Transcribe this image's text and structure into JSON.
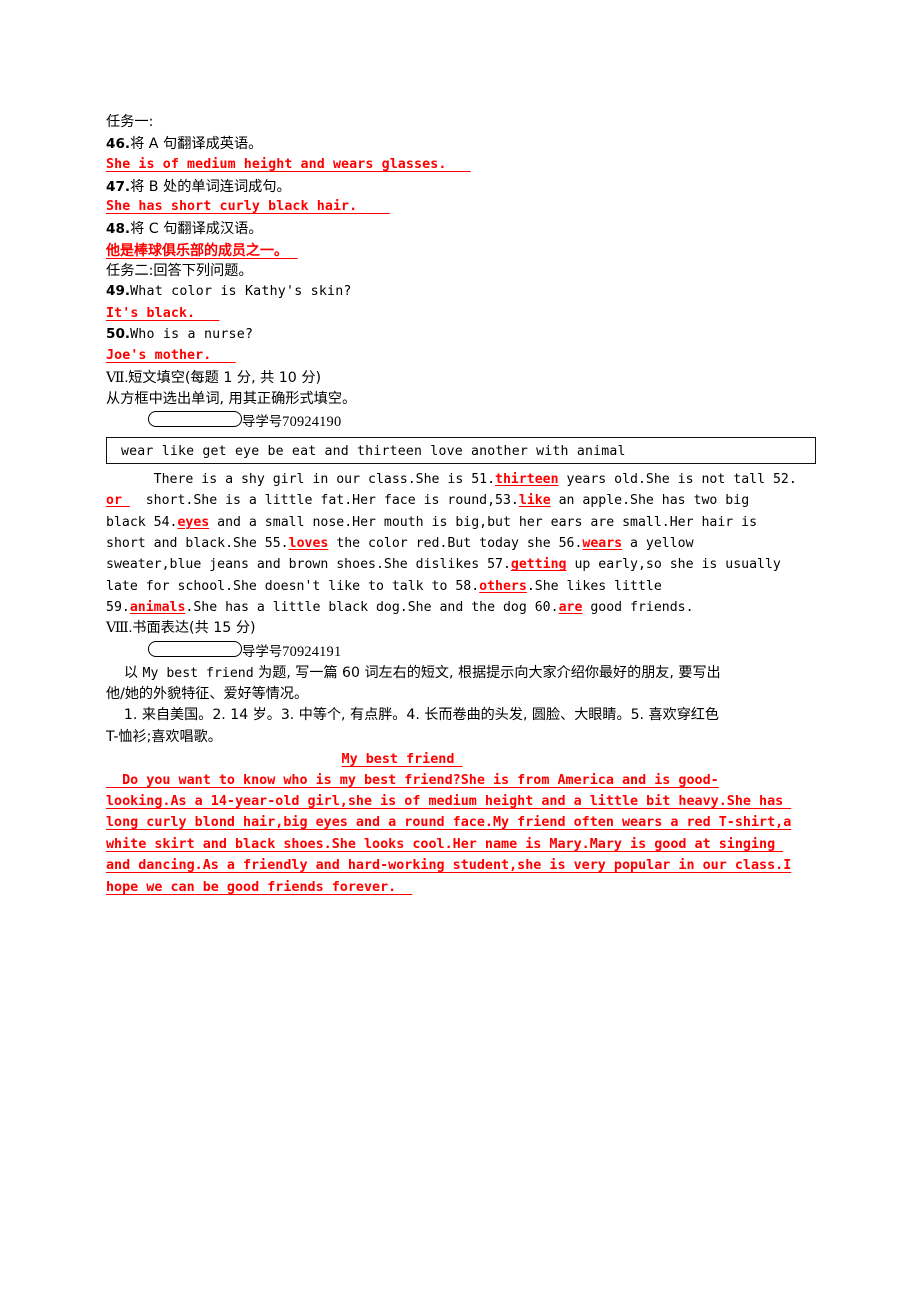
{
  "task_one": {
    "heading": "任务一:",
    "items": [
      {
        "num": "46.",
        "prompt": "将 A 句翻译成英语。",
        "answer": "She is of medium height and wears glasses.",
        "answer_lang": "en"
      },
      {
        "num": "47.",
        "prompt": "将 B 处的单词连词成句。",
        "answer": "She has short curly black hair.",
        "answer_lang": "en"
      },
      {
        "num": "48.",
        "prompt": "将 C 句翻译成汉语。",
        "answer": "他是棒球俱乐部的成员之一。",
        "answer_lang": "cn"
      }
    ]
  },
  "task_two": {
    "heading": "任务二:回答下列问题。",
    "items": [
      {
        "num": "49.",
        "prompt": "What color is Kathy's skin?",
        "answer": "It's black.",
        "answer_lang": "en"
      },
      {
        "num": "50.",
        "prompt": "Who is a nurse?",
        "answer": "Joe's mother.",
        "answer_lang": "en"
      }
    ]
  },
  "section_seven": {
    "number": "Ⅶ.",
    "title": "短文填空(每题 1 分, 共 10 分)",
    "instruction": "从方框中选出单词, 用其正确形式填空。",
    "guide_label": "导学号",
    "guide_number": "70924190",
    "word_bank": "wear  like  get  eye  be  eat  and  thirteen  love  another  with  animal",
    "passage_lines": [
      [
        {
          "t": "      There is a shy girl in our class.She is 51."
        },
        {
          "t": "thirteen",
          "fill": true
        },
        {
          "t": " years old.She is not tall 52."
        }
      ],
      [
        {
          "t": "or ",
          "fill": true
        },
        {
          "t": "  short.She is a little fat.Her face is round,53."
        },
        {
          "t": "like",
          "fill": true
        },
        {
          "t": " an apple.She has two big"
        }
      ],
      [
        {
          "t": "black 54."
        },
        {
          "t": "eyes",
          "fill": true
        },
        {
          "t": " and a small nose.Her mouth is big,but her ears are small.Her hair is"
        }
      ],
      [
        {
          "t": "short and black.She 55."
        },
        {
          "t": "loves",
          "fill": true
        },
        {
          "t": " the color red.But today she 56."
        },
        {
          "t": "wears",
          "fill": true
        },
        {
          "t": " a yellow"
        }
      ],
      [
        {
          "t": "sweater,blue jeans and brown shoes.She dislikes 57."
        },
        {
          "t": "getting",
          "fill": true
        },
        {
          "t": " up early,so she is usually"
        }
      ],
      [
        {
          "t": "late for school.She doesn't like to talk to 58."
        },
        {
          "t": "others",
          "fill": true
        },
        {
          "t": ".She likes little"
        }
      ],
      [
        {
          "t": "59."
        },
        {
          "t": "animals",
          "fill": true
        },
        {
          "t": ".She has a little black dog.She and the dog 60."
        },
        {
          "t": "are",
          "fill": true
        },
        {
          "t": " good friends."
        }
      ]
    ]
  },
  "section_eight": {
    "number": "Ⅷ.",
    "title": "书面表达(共 15 分)",
    "guide_label": "导学号",
    "guide_number": "70924191",
    "prompt_lines": [
      "    以 My best friend 为题, 写一篇 60 词左右的短文, 根据提示向大家介绍你最好的朋友, 要写出",
      "他/她的外貌特征、爱好等情况。",
      "    1. 来自美国。2. 14 岁。3. 中等个, 有点胖。4. 长而卷曲的头发, 圆脸、大眼睛。5. 喜欢穿红色",
      "T-恤衫;喜欢唱歌。"
    ],
    "prompt_title_en": "My best friend",
    "composition_title": "My best friend ",
    "composition_lines": [
      "  Do you want to know who is my best friend?She is from America and is good-",
      "looking.As a 14-year-old girl,she is of medium height and a little bit heavy.She has ",
      "long curly blond hair,big eyes and a round face.My friend often wears a red T-shirt,a",
      "white skirt and black shoes.She looks cool.Her name is Mary.Mary is good at singing ",
      "and dancing.As a friendly and hard-working student,she is very popular in our class.I",
      "hope we can be good friends forever.  "
    ]
  },
  "colors": {
    "answer_red": "#ff0000",
    "text_black": "#000000"
  }
}
